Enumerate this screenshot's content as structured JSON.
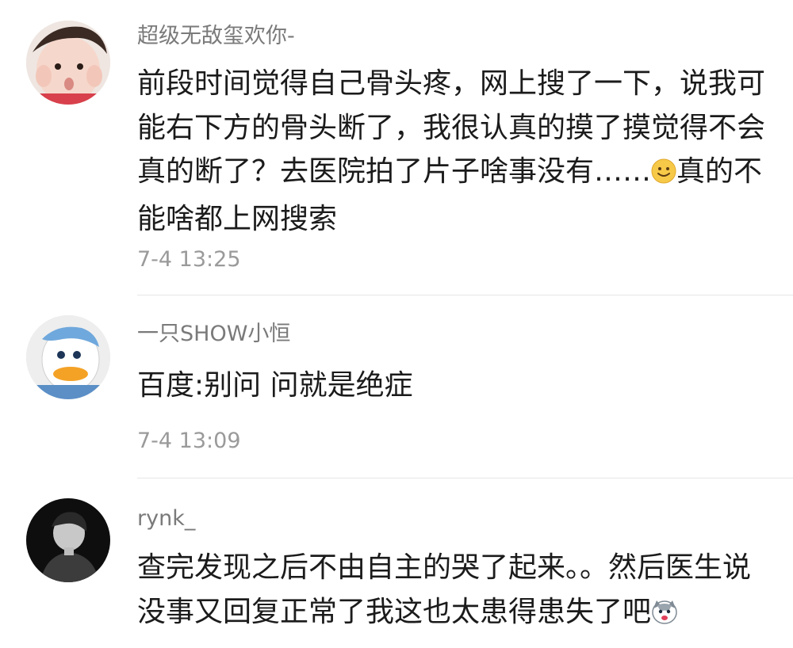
{
  "comments": [
    {
      "username": "超级无敌玺欢你-",
      "text_before_emoji": "前段时间觉得自己骨头疼，网上搜了一下，说我可能右下方的骨头断了，我很认真的摸了摸觉得不会真的断了？去医院拍了片子啥事没有……",
      "emoji": "smile-emoji",
      "text_after_emoji": "真的不能啥都上网搜索",
      "time": "7-4 13:25"
    },
    {
      "username": "一只SHOW小恒",
      "text_before_emoji": "百度:别问 问就是绝症",
      "time": "7-4 13:09"
    },
    {
      "username": "rynk_",
      "text_before_emoji": "查完发现之后不由自主的哭了起来。。然后医生说没事又回复正常了我这也太患得患失了吧",
      "emoji": "husky-emoji"
    }
  ]
}
